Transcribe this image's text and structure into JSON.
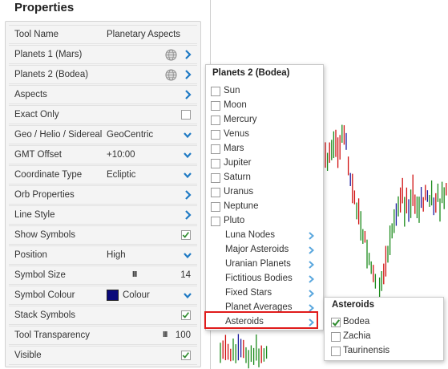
{
  "panel": {
    "title": "Properties",
    "rows": [
      {
        "label": "Tool Name",
        "value": "Planetary Aspects"
      },
      {
        "label": "Planets 1 (Mars)"
      },
      {
        "label": "Planets 2 (Bodea)"
      },
      {
        "label": "Aspects"
      },
      {
        "label": "Exact Only",
        "checked": false
      },
      {
        "label": "Geo / Helio / Sidereal",
        "value": "GeoCentric"
      },
      {
        "label": "GMT Offset",
        "value": "+10:00"
      },
      {
        "label": "Coordinate Type",
        "value": "Ecliptic"
      },
      {
        "label": "Orb Properties"
      },
      {
        "label": "Line Style"
      },
      {
        "label": "Show Symbols",
        "checked": true
      },
      {
        "label": "Position",
        "value": "High"
      },
      {
        "label": "Symbol Size",
        "bars": "III",
        "value": "14"
      },
      {
        "label": "Symbol Colour",
        "value": "Colour",
        "color": "#0b0a7a"
      },
      {
        "label": "Stack Symbols",
        "checked": true
      },
      {
        "label": "Tool Transparency",
        "bars": "III",
        "value": "100"
      },
      {
        "label": "Visible",
        "checked": true
      }
    ]
  },
  "planets_menu": {
    "title": "Planets 2 (Bodea)",
    "planets": [
      "Sun",
      "Moon",
      "Mercury",
      "Venus",
      "Mars",
      "Jupiter",
      "Saturn",
      "Uranus",
      "Neptune",
      "Pluto"
    ],
    "submenus": [
      "Luna Nodes",
      "Major Asteroids",
      "Uranian Planets",
      "Fictitious Bodies",
      "Fixed Stars",
      "Planet Averages",
      "Asteroids"
    ],
    "highlighted": "Asteroids"
  },
  "asteroids_menu": {
    "title": "Asteroids",
    "items": [
      {
        "label": "Bodea",
        "checked": true
      },
      {
        "label": "Zachia",
        "checked": false
      },
      {
        "label": "Taurinensis",
        "checked": false
      }
    ]
  },
  "colors": {
    "accent": "#1f7ac4",
    "check": "#2e8b2e",
    "highlight": "#e01b1b",
    "bar_up": "#1a8a1a",
    "bar_down": "#d01010",
    "bar_neutral": "#1a1aa0"
  }
}
